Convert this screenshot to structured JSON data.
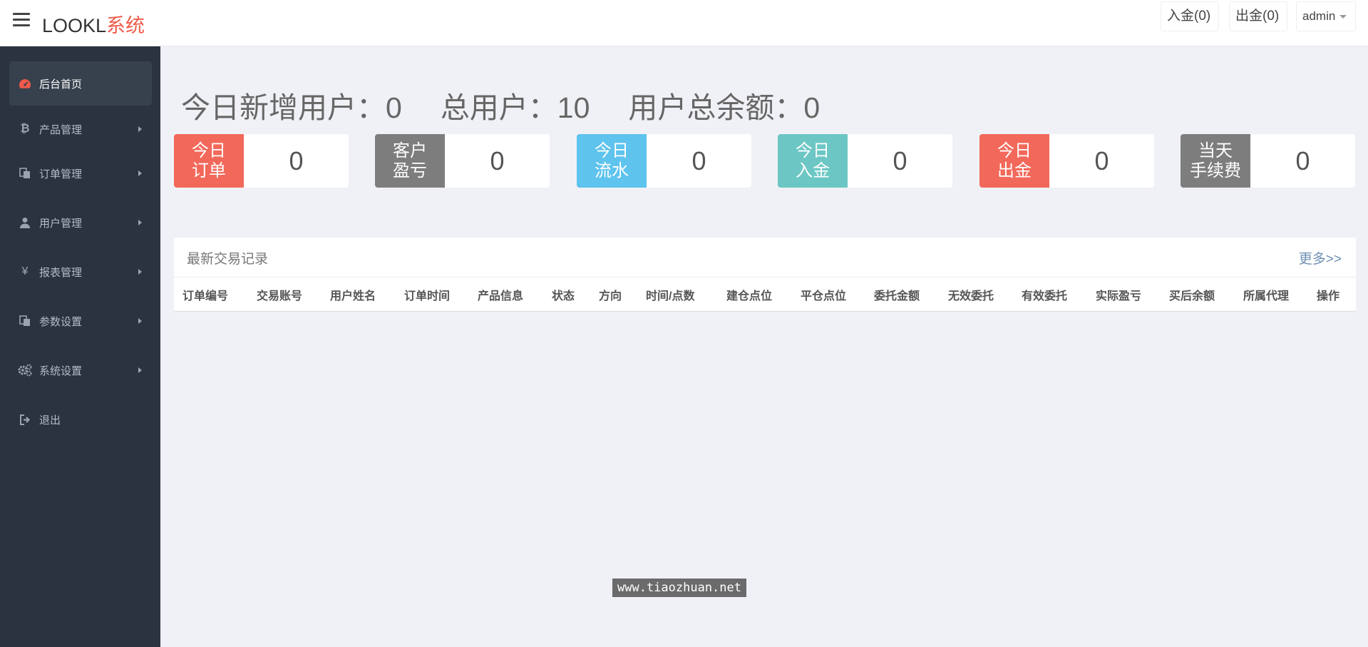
{
  "header": {
    "brand_main": "LOOKL",
    "brand_accent": "系统",
    "deposit_btn": "入金(0)",
    "withdraw_btn": "出金(0)",
    "admin_btn": "admin"
  },
  "sidebar": {
    "items": [
      {
        "label": "后台首页",
        "icon": "dashboard-icon"
      },
      {
        "label": "产品管理",
        "icon": "bitcoin-icon"
      },
      {
        "label": "订单管理",
        "icon": "copy-icon"
      },
      {
        "label": "用户管理",
        "icon": "user-icon"
      },
      {
        "label": "报表管理",
        "icon": "yen-icon"
      },
      {
        "label": "参数设置",
        "icon": "copy-icon"
      },
      {
        "label": "系统设置",
        "icon": "gears-icon"
      },
      {
        "label": "退出",
        "icon": "sign-out-icon"
      }
    ]
  },
  "headline": {
    "new_users": "今日新增用户：0",
    "total_users": "总用户：10",
    "total_balance": "用户总余额：0"
  },
  "stats": [
    {
      "label_1": "今日",
      "label_2": "订单",
      "value": "0",
      "color": "#f2685a"
    },
    {
      "label_1": "客户",
      "label_2": "盈亏",
      "value": "0",
      "color": "#7d7d7d"
    },
    {
      "label_1": "今日",
      "label_2": "流水",
      "value": "0",
      "color": "#5ec3ed"
    },
    {
      "label_1": "今日",
      "label_2": "入金",
      "value": "0",
      "color": "#6cc7c4"
    },
    {
      "label_1": "今日",
      "label_2": "出金",
      "value": "0",
      "color": "#f2685a"
    },
    {
      "label_1": "当天",
      "label_2": "手续费",
      "value": "0",
      "color": "#7d7d7d"
    }
  ],
  "records": {
    "title": "最新交易记录",
    "more": "更多>>",
    "columns": [
      "订单编号",
      "交易账号",
      "用户姓名",
      "订单时间",
      "产品信息",
      "状态",
      "方向",
      "时间/点数",
      "建仓点位",
      "平仓点位",
      "委托金额",
      "无效委托",
      "有效委托",
      "实际盈亏",
      "买后余额",
      "所属代理",
      "操作"
    ]
  },
  "watermark": "www.tiaozhuan.net"
}
